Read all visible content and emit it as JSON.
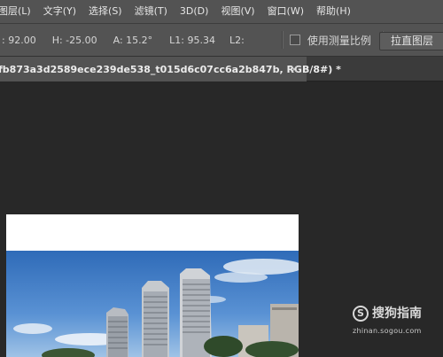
{
  "menu": {
    "items": [
      "图层(L)",
      "文字(Y)",
      "选择(S)",
      "滤镜(T)",
      "3D(D)",
      "视图(V)",
      "窗口(W)",
      "帮助(H)"
    ]
  },
  "options": {
    "x_field": ": 92.00",
    "h_field": "H: -25.00",
    "a_field": "A: 15.2°",
    "l1_field": "L1: 95.34",
    "l2_field": "L2:",
    "measure_scale_label": "使用测量比例",
    "measure_scale_checked": false,
    "straighten_button": "拉直图层"
  },
  "document": {
    "tab_title": "fb873a3d2589ece239de538_t015d6c07cc6a2b847b, RGB/8#) *",
    "close_symbol": "×"
  },
  "watermark": {
    "logo": "S",
    "text": "搜狗指南",
    "url": "zhinan.sogou.com"
  },
  "colors": {
    "menubar": "#535353",
    "workspace": "#282828",
    "sky": "#3a78c4"
  }
}
